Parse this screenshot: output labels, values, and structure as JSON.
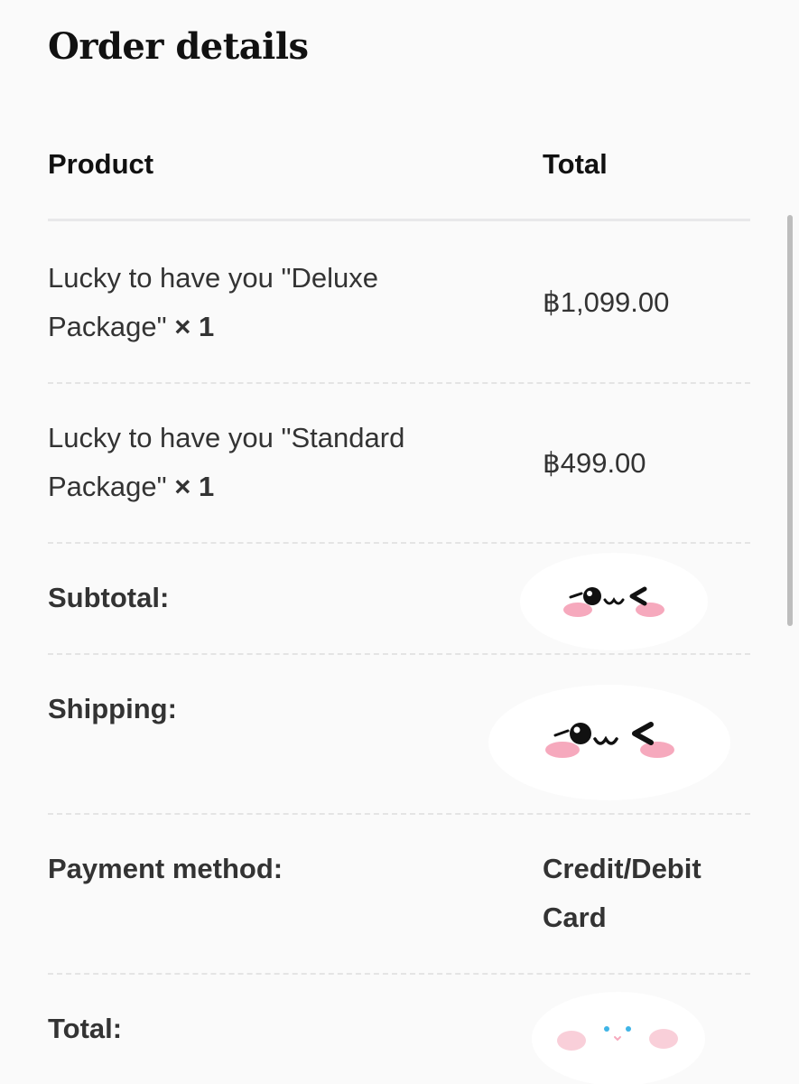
{
  "page": {
    "title": "Order details"
  },
  "table": {
    "header": {
      "product": "Product",
      "total": "Total"
    },
    "items": [
      {
        "name_line1": "Lucky to have you \"Deluxe",
        "name_line2": "Package\"",
        "qty": "× 1",
        "price": "฿1,099.00"
      },
      {
        "name_line1": "Lucky to have you \"Standard",
        "name_line2": "Package\"",
        "qty": "× 1",
        "price": "฿499.00"
      }
    ],
    "summary": {
      "subtotal_label": "Subtotal:",
      "shipping_label": "Shipping:",
      "payment_label": "Payment method:",
      "payment_value_line1": "Credit/Debit",
      "payment_value_line2": "Card",
      "total_label": "Total:"
    }
  },
  "stickers": [
    {
      "name": "winking-face-sticker",
      "covers": "Subtotal value"
    },
    {
      "name": "winking-face-sticker",
      "covers": "Shipping value"
    },
    {
      "name": "cute-face-sticker",
      "covers": "Total value"
    }
  ],
  "colors": {
    "background": "#fafafa",
    "text": "#2b2b2b",
    "divider": "#e4e4e4",
    "blush": "#f6a9bd",
    "eye_blue": "#3fb4e6"
  }
}
